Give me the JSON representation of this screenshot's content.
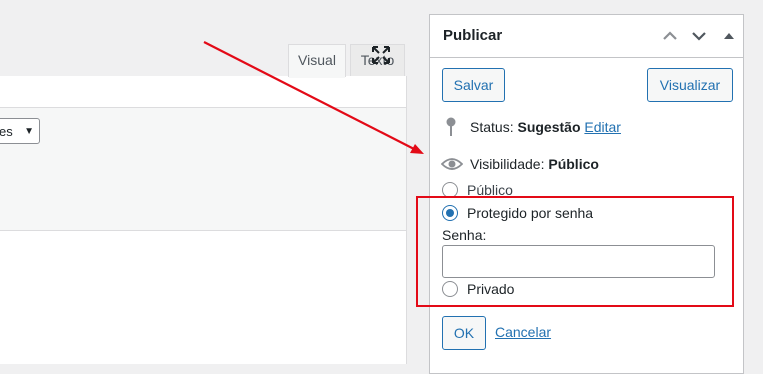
{
  "editor": {
    "tabs": [
      {
        "label": "Visual"
      },
      {
        "label": "Texto"
      }
    ],
    "format_select_value": "es"
  },
  "publish": {
    "title": "Publicar",
    "save_label": "Salvar",
    "preview_label": "Visualizar",
    "status_label": "Status:",
    "status_value": "Sugestão",
    "status_edit": "Editar",
    "visibility_label": "Visibilidade:",
    "visibility_value": "Público",
    "options": {
      "public": "Público",
      "protected": "Protegido por senha",
      "private": "Privado"
    },
    "selected_option": "protected",
    "password_label": "Senha:",
    "password_value": "",
    "ok_label": "OK",
    "cancel_label": "Cancelar"
  },
  "colors": {
    "accent": "#2271b1",
    "annotation": "#e30a17"
  },
  "icons": {
    "collapse_up": "chevron-up-icon",
    "move_down": "chevron-down-icon",
    "toggle": "triangle-up-icon",
    "status": "pin-icon",
    "visibility": "eye-icon",
    "fullscreen": "fullscreen-icon"
  }
}
